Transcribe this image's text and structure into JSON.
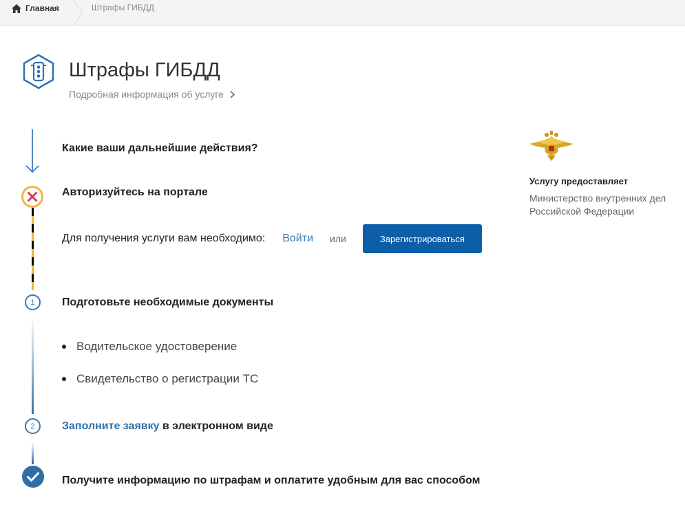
{
  "breadcrumb": {
    "home_label": "Главная",
    "current_label": "Штрафы ГИБДД"
  },
  "service": {
    "title": "Штрафы ГИБДД",
    "details_link": "Подробная информация об услуге"
  },
  "steps": {
    "intro_title": "Какие ваши дальнейшие действия?",
    "auth": {
      "title": "Авторизуйтесь на портале",
      "prompt": "Для получения услуги вам необходимо:",
      "login_link": "Войти",
      "or_text": "или",
      "register_button": "Зарегистрироваться"
    },
    "step1": {
      "number": "1",
      "title": "Подготовьте необходимые документы",
      "documents": [
        "Водительское удостоверение",
        "Свидетельство о регистрации ТС"
      ]
    },
    "step2": {
      "number": "2",
      "link_text": "Заполните заявку",
      "rest_text": " в электронном виде"
    },
    "final": {
      "title": "Получите информацию по штрафам и оплатите удобным для вас способом"
    }
  },
  "agency": {
    "label": "Услугу предоставляет",
    "name": "Министерство внутренних дел Российской Федерации"
  },
  "colors": {
    "accent": "#0d5ea8",
    "link": "#3a79b6",
    "error_ring": "#f6b33d",
    "error_cross": "#e0344c",
    "done": "#2d6ea6"
  },
  "icons": {
    "home": "home-icon",
    "crumb_separator": "chevron-right-icon",
    "service": "traffic-light-icon",
    "intro": "arrow-down-icon",
    "auth_status": "error-x-icon",
    "final_status": "checkmark-icon",
    "agency": "double-headed-eagle-emblem"
  }
}
